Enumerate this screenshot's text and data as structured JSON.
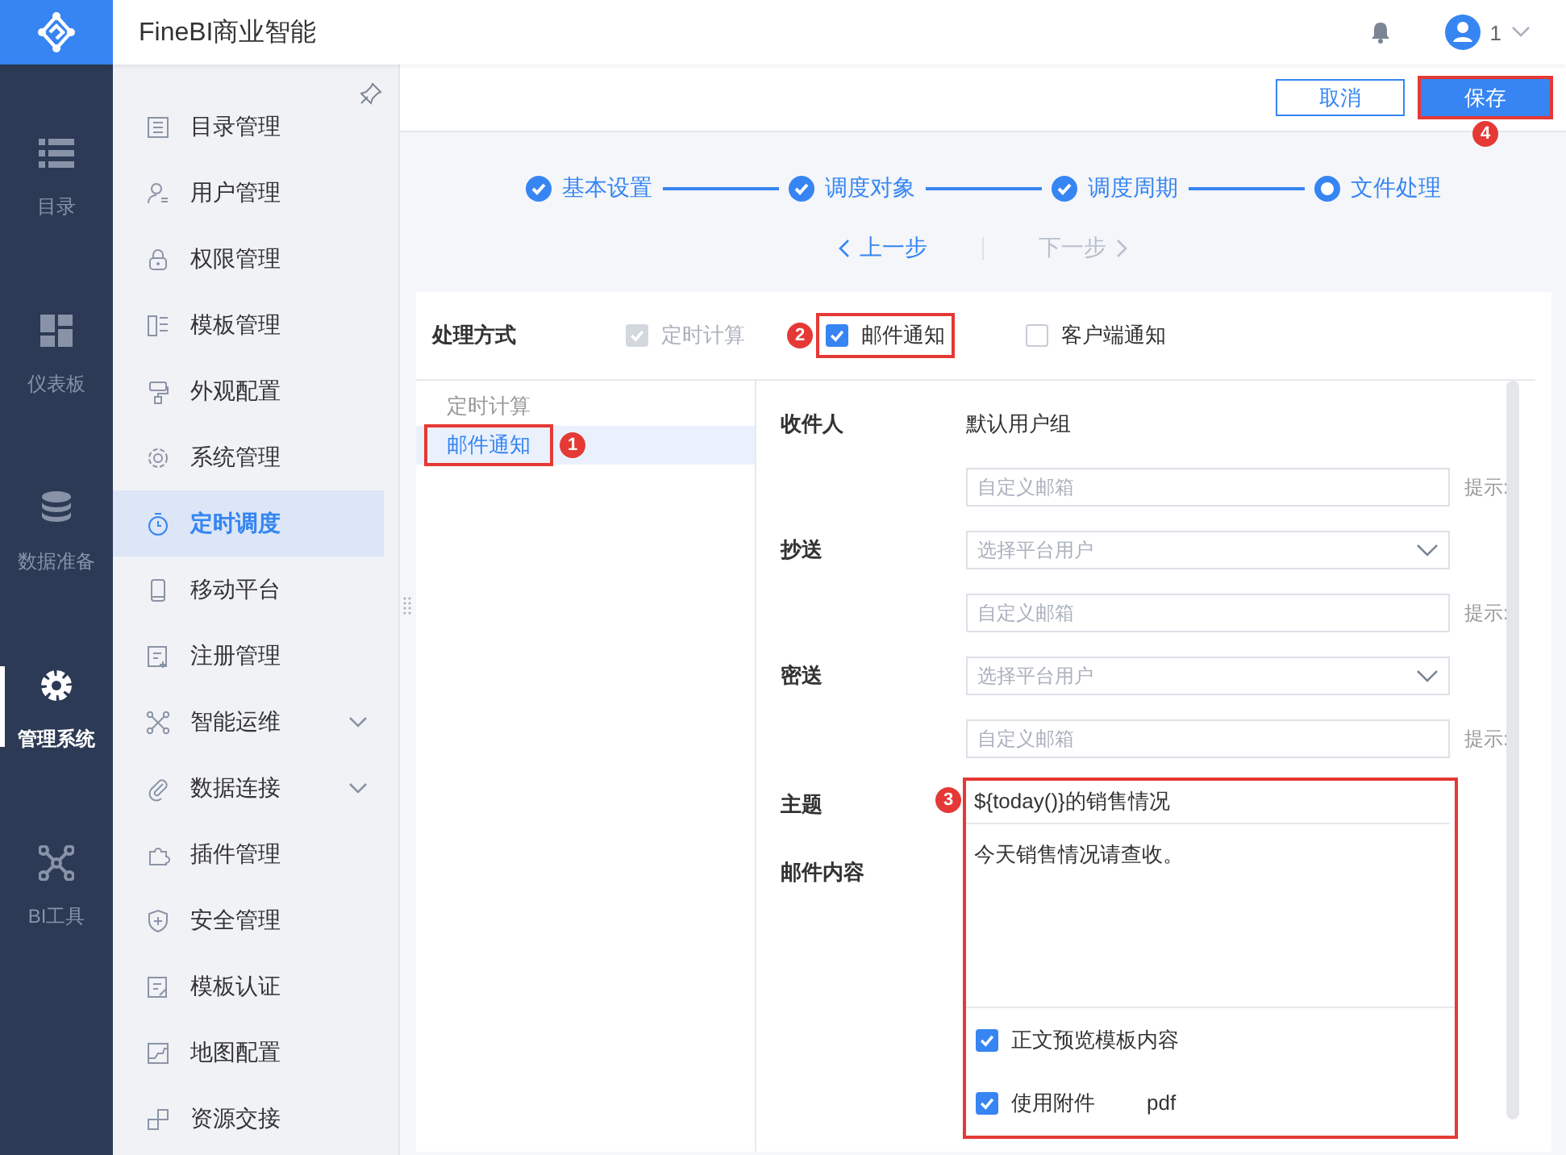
{
  "app": {
    "title": "FineBI商业智能",
    "user": "1"
  },
  "nav": [
    {
      "label": "目录",
      "selected": false
    },
    {
      "label": "仪表板",
      "selected": false
    },
    {
      "label": "数据准备",
      "selected": false
    },
    {
      "label": "管理系统",
      "selected": true
    },
    {
      "label": "BI工具",
      "selected": false
    }
  ],
  "menu": [
    {
      "label": "目录管理",
      "selected": false,
      "expandable": false
    },
    {
      "label": "用户管理",
      "selected": false,
      "expandable": false
    },
    {
      "label": "权限管理",
      "selected": false,
      "expandable": false
    },
    {
      "label": "模板管理",
      "selected": false,
      "expandable": false
    },
    {
      "label": "外观配置",
      "selected": false,
      "expandable": false
    },
    {
      "label": "系统管理",
      "selected": false,
      "expandable": false
    },
    {
      "label": "定时调度",
      "selected": true,
      "expandable": false
    },
    {
      "label": "移动平台",
      "selected": false,
      "expandable": false
    },
    {
      "label": "注册管理",
      "selected": false,
      "expandable": false
    },
    {
      "label": "智能运维",
      "selected": false,
      "expandable": true
    },
    {
      "label": "数据连接",
      "selected": false,
      "expandable": true
    },
    {
      "label": "插件管理",
      "selected": false,
      "expandable": false
    },
    {
      "label": "安全管理",
      "selected": false,
      "expandable": false
    },
    {
      "label": "模板认证",
      "selected": false,
      "expandable": false
    },
    {
      "label": "地图配置",
      "selected": false,
      "expandable": false
    },
    {
      "label": "资源交接",
      "selected": false,
      "expandable": false
    }
  ],
  "toolbar": [
    {
      "label": "取消",
      "kind": "secondary"
    },
    {
      "label": "保存",
      "kind": "primary",
      "callout": "4"
    }
  ],
  "steps": [
    {
      "label": "基本设置",
      "completed": true
    },
    {
      "label": "调度对象",
      "completed": true
    },
    {
      "label": "调度周期",
      "completed": true
    },
    {
      "label": "文件处理",
      "completed": false
    }
  ],
  "step_nav": [
    {
      "label": "上一步",
      "disabled": false
    },
    {
      "label": "下一步",
      "disabled": true
    }
  ],
  "processing": {
    "label": "处理方式",
    "options": [
      {
        "label": "定时计算",
        "checked": true,
        "disabled": true
      },
      {
        "label": "邮件通知",
        "checked": true,
        "disabled": false,
        "callout": "2"
      },
      {
        "label": "客户端通知",
        "checked": false,
        "disabled": false
      }
    ]
  },
  "sub_list": [
    {
      "label": "定时计算",
      "selected": false
    },
    {
      "label": "邮件通知",
      "selected": true,
      "callout": "1"
    }
  ],
  "form": [
    {
      "kind": "text",
      "label": "收件人",
      "value": "默认用户组"
    },
    {
      "kind": "input",
      "placeholder": "自定义邮箱",
      "hint": "提示:"
    },
    {
      "kind": "select",
      "label": "抄送",
      "placeholder": "选择平台用户"
    },
    {
      "kind": "input",
      "placeholder": "自定义邮箱",
      "hint": "提示:"
    },
    {
      "kind": "select",
      "label": "密送",
      "placeholder": "选择平台用户"
    },
    {
      "kind": "input",
      "placeholder": "自定义邮箱",
      "hint": "提示:"
    }
  ],
  "mail": {
    "callout": "3",
    "subject_label": "主题",
    "subject": "${today()}的销售情况",
    "content_label": "邮件内容",
    "content": "今天销售情况请查收。",
    "options": [
      {
        "label": "正文预览模板内容",
        "checked": true
      },
      {
        "label": "使用附件",
        "checked": true,
        "value": "pdf"
      }
    ]
  }
}
